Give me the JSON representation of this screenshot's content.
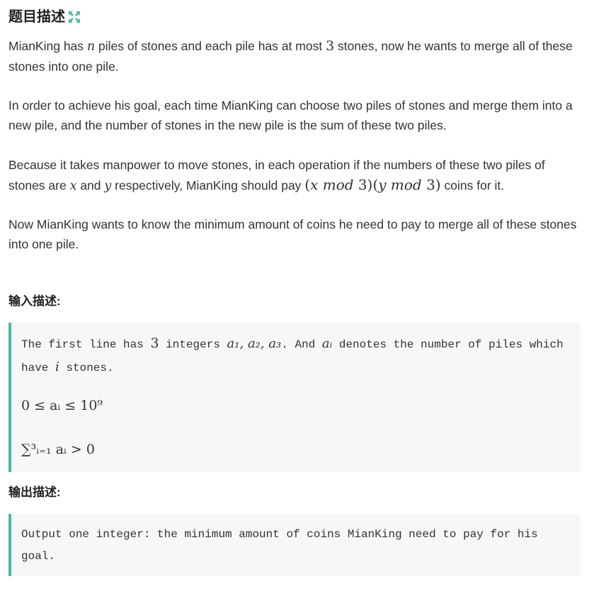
{
  "description": {
    "title": "题目描述",
    "icon": "expand-icon",
    "paragraphs": {
      "p1_a": "MianKing has ",
      "p1_n": "n",
      "p1_b": " piles of stones and each pile has at most ",
      "p1_3": "3",
      "p1_c": " stones, now he wants to merge all of these stones into one pile.",
      "p2": "In order to achieve his goal, each time MianKing can choose two piles of stones and merge them into a new pile, and the number of stones in the new pile is the sum of these two piles.",
      "p3_a": "Because it takes manpower to move stones, in each operation if the numbers of these two piles of stones are ",
      "p3_x": "x",
      "p3_and": " and ",
      "p3_y": "y",
      "p3_b": " respectively, MianKing should pay ",
      "p3_formula_open": "(",
      "p3_formula_x": "x mod ",
      "p3_formula_3a": "3",
      "p3_formula_mid": ")(",
      "p3_formula_y": "y mod ",
      "p3_formula_3b": "3",
      "p3_formula_close": ")",
      "p3_c": " coins for it.",
      "p4": "Now MianKing wants to know the minimum amount of coins he need to pay to merge all of these stones into one pile."
    }
  },
  "input": {
    "title": "输入描述:",
    "line1_a": "The first line has ",
    "line1_3": "3",
    "line1_b": " integers ",
    "line1_vars": "a₁, a₂, a₃",
    "line1_c": ". And ",
    "line1_ai": "aᵢ",
    "line1_d": " denotes the number of piles which have ",
    "line1_i": "i",
    "line1_e": " stones.",
    "constraint1": "0 ≤ aᵢ ≤ 10⁹",
    "constraint2": "∑³ᵢ₌₁ aᵢ > 0"
  },
  "output": {
    "title": "输出描述:",
    "text": "Output one integer: the minimum amount of coins MianKing need to pay for his goal."
  },
  "colors": {
    "accent": "#4bb9a2",
    "box_bg": "#f7f7f7",
    "text": "#333333"
  }
}
